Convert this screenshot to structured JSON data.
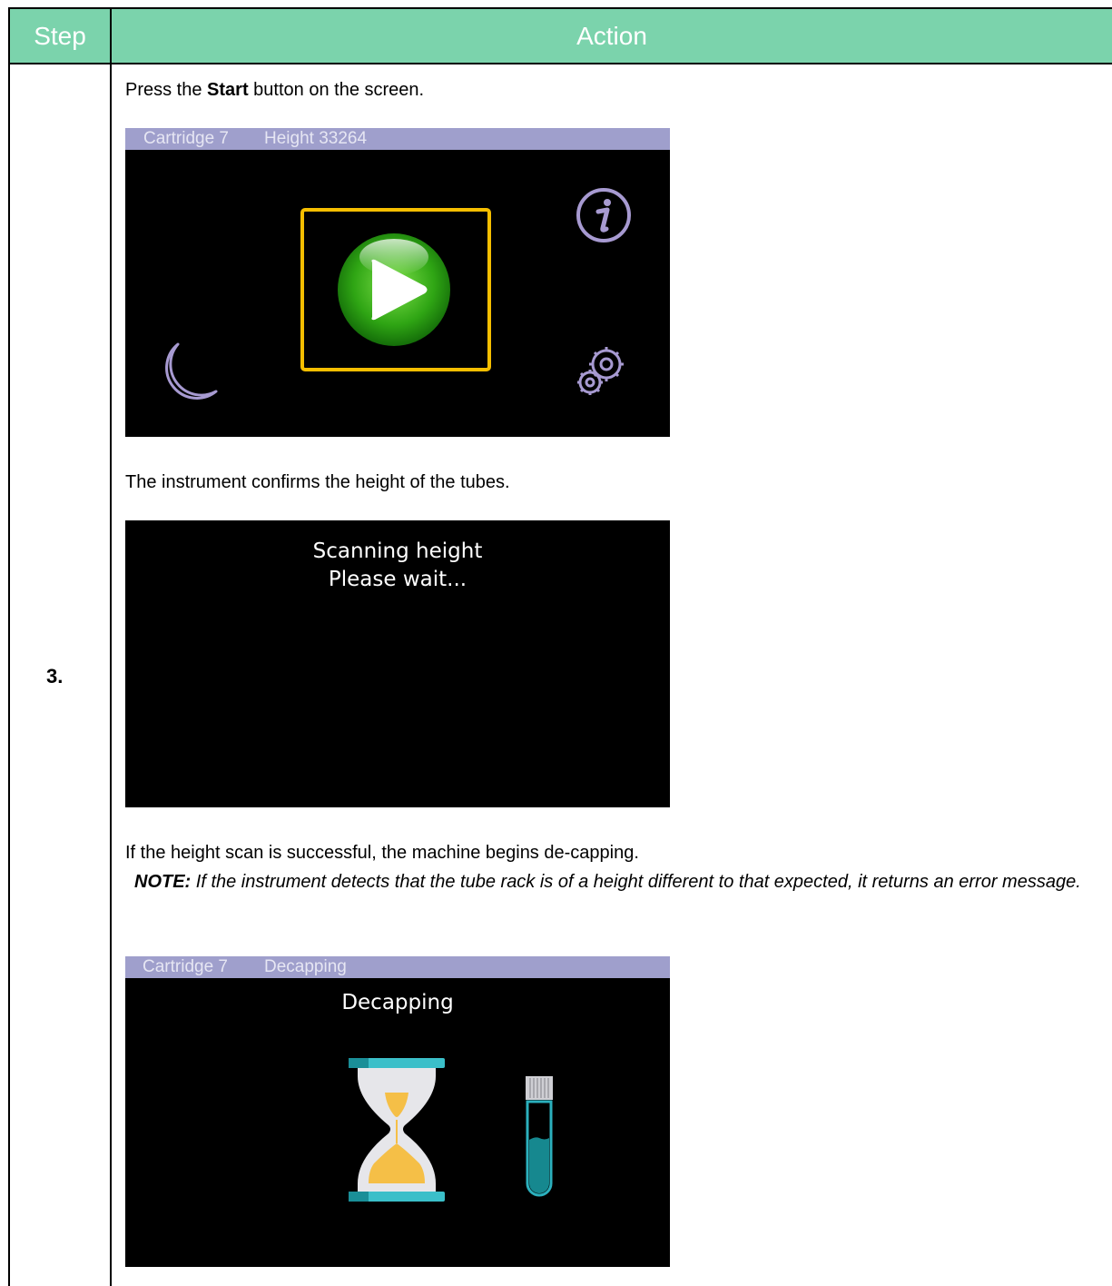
{
  "table": {
    "header_step": "Step",
    "header_action": "Action",
    "step_number": "3."
  },
  "instructions": {
    "line1_prefix": "Press the ",
    "line1_bold": "Start",
    "line1_suffix": " button on the screen.",
    "line2": "The instrument confirms the height of the tubes.",
    "line3": "If the height scan is successful, the machine begins de-capping.",
    "note_label": "NOTE:",
    "note_text": " If the instrument detects that the tube rack is of a height different to that expected, it returns an error message."
  },
  "screen1": {
    "status_cartridge": "Cartridge 7",
    "status_info": "Height 33264",
    "icons": [
      "play-icon",
      "info-icon",
      "moon-icon",
      "gears-icon"
    ],
    "highlight_color": "#f5be00"
  },
  "screen2": {
    "line1": "Scanning height",
    "line2": "Please wait..."
  },
  "screen3": {
    "status_cartridge": "Cartridge 7",
    "status_info": "Decapping",
    "title": "Decapping",
    "icons": [
      "hourglass-icon",
      "test-tube-icon"
    ]
  },
  "colors": {
    "header_bg": "#7bd3ac",
    "status_bar_bg": "#9f9fcc",
    "icon_outline": "#a79ad1"
  }
}
